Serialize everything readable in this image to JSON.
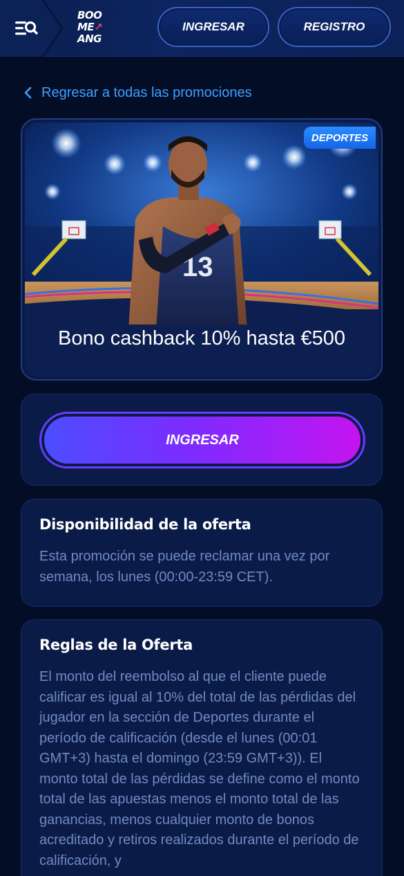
{
  "header": {
    "logo_lines": [
      "BOO",
      "ME",
      "ANG"
    ],
    "login_label": "INGRESAR",
    "register_label": "REGISTRO"
  },
  "back_link": {
    "label": "Regresar a todas las promociones"
  },
  "promo": {
    "badge": "DEPORTES",
    "title": "Bono cashback 10% hasta €500",
    "jersey_number": "13"
  },
  "cta": {
    "label": "INGRESAR"
  },
  "availability": {
    "title": "Disponibilidad de la oferta",
    "text": "Esta promoción se puede reclamar una vez por semana, los lunes (00:00-23:59 CET)."
  },
  "rules": {
    "title": "Reglas de la Oferta",
    "text": "El monto del reembolso al que el cliente puede calificar es igual al 10% del total de las pérdidas del jugador en la sección de Deportes durante el período de calificación (desde el lunes (00:01 GMT+3) hasta el domingo (23:59 GMT+3)). El monto total de las pérdidas se define como el monto total de las apuestas menos el monto total de las ganancias, menos cualquier monto de bonos acreditado y retiros realizados durante el período de calificación, y"
  },
  "colors": {
    "background": "#030d26",
    "card": "#0b1b47",
    "link": "#3fa0ff",
    "muted_text": "#6f8ac2",
    "badge": "#1e78ff",
    "cta_gradient_start": "#4d4dff",
    "cta_gradient_end": "#c414f0"
  },
  "icons": {
    "menu": "menu-search-icon",
    "back": "chevron-left-icon"
  }
}
